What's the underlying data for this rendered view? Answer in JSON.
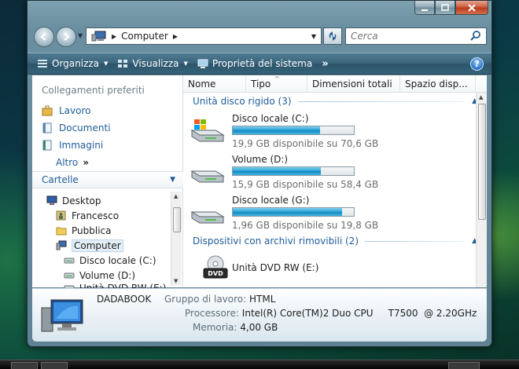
{
  "window": {
    "title": "Computer"
  },
  "address": {
    "location": "Computer",
    "search_placeholder": "Cerca"
  },
  "toolbar": {
    "organize": "Organizza",
    "view": "Visualizza",
    "system_properties": "Proprietà del sistema"
  },
  "navigation": {
    "favorites_heading": "Collegamenti preferiti",
    "favorites": [
      {
        "label": "Lavoro",
        "icon": "briefcase-icon"
      },
      {
        "label": "Documenti",
        "icon": "documents-icon"
      },
      {
        "label": "Immagini",
        "icon": "pictures-icon"
      }
    ],
    "more": "Altro",
    "folders_heading": "Cartelle",
    "tree": [
      {
        "label": "Desktop",
        "icon": "desktop-icon"
      },
      {
        "label": "Francesco",
        "icon": "user-folder-icon"
      },
      {
        "label": "Pubblica",
        "icon": "folder-icon"
      },
      {
        "label": "Computer",
        "icon": "computer-icon",
        "selected": true
      },
      {
        "label": "Disco locale (C:)",
        "icon": "drive-icon"
      },
      {
        "label": "Volume (D:)",
        "icon": "drive-icon"
      },
      {
        "label": "Unità DVD RW (E:)",
        "icon": "dvd-icon"
      }
    ]
  },
  "columns": [
    "Nome",
    "Tipo",
    "Dimensioni totali",
    "Spazio disp..."
  ],
  "groups": {
    "hard_disks": {
      "label": "Unità disco rigido (3)",
      "drives": [
        {
          "name": "Disco locale (C:)",
          "free_text": "19,9 GB disponibile su 70,6 GB",
          "used_fraction": 0.718
        },
        {
          "name": "Volume (D:)",
          "free_text": "15,9 GB disponibile su 58,4 GB",
          "used_fraction": 0.728
        },
        {
          "name": "Disco locale (G:)",
          "free_text": "1,96 GB disponibile su 19,8 GB",
          "used_fraction": 0.901
        }
      ]
    },
    "removable": {
      "label": "Dispositivi con archivi rimovibili (2)",
      "devices": [
        {
          "name": "Unità DVD RW (E:)",
          "badge": "DVD"
        }
      ]
    }
  },
  "details": {
    "computer_name": "DADABOOK",
    "workgroup_label": "Gruppo di lavoro:",
    "workgroup_value": "HTML",
    "processor_label": "Processore:",
    "processor_value": "Intel(R) Core(TM)2 Duo CPU     T7500  @ 2.20GHz",
    "memory_label": "Memoria:",
    "memory_value": "4,00 GB"
  },
  "colors": {
    "accent_link": "#1f5c99",
    "bar_fill": "#26a0d4",
    "toolbar": "#3b657c"
  }
}
